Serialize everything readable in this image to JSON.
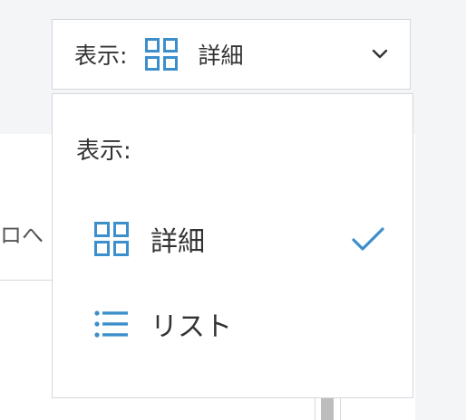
{
  "background": {
    "row_text": "ロへ"
  },
  "view_select": {
    "label": "表示:",
    "selected_value": "詳細",
    "selected_icon": "grid-icon",
    "toggle_icon": "chevron-down-icon"
  },
  "menu": {
    "header": "表示:",
    "items": [
      {
        "label": "詳細",
        "icon": "grid-icon",
        "selected": true
      },
      {
        "label": "リスト",
        "icon": "list-icon",
        "selected": false
      }
    ],
    "check_icon": "check-icon"
  },
  "colors": {
    "accent": "#3d8fcc",
    "text": "#333333",
    "border": "#d3d7dc"
  }
}
